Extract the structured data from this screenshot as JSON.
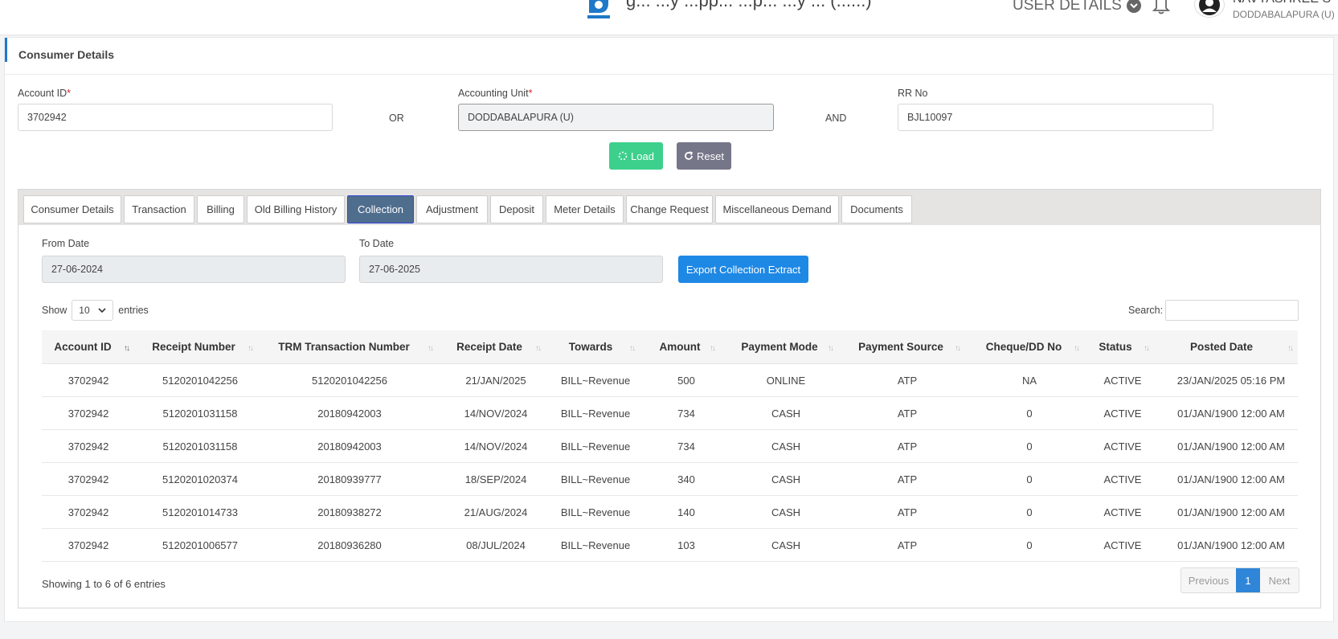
{
  "header": {
    "app_title": "g... ...y ...pp... ...p... ...y ... (......)",
    "user_details_label": "USER DETAILS",
    "user_name": "NAVYASHREE S",
    "user_location": "DODDABALAPURA (U)"
  },
  "card": {
    "title": "Consumer Details"
  },
  "form": {
    "account_id_label": "Account ID",
    "account_id_value": "3702942",
    "or_label": "OR",
    "accounting_unit_label": "Accounting Unit",
    "accounting_unit_value": "DODDABALAPURA (U)",
    "and_label": "AND",
    "rr_no_label": "RR No",
    "rr_no_value": "BJL10097",
    "required_mark": "*",
    "load_label": "Load",
    "reset_label": "Reset"
  },
  "tabs": [
    {
      "label": "Consumer Details"
    },
    {
      "label": "Transaction"
    },
    {
      "label": "Billing"
    },
    {
      "label": "Old Billing History"
    },
    {
      "label": "Collection"
    },
    {
      "label": "Adjustment"
    },
    {
      "label": "Deposit"
    },
    {
      "label": "Meter Details"
    },
    {
      "label": "Change Request"
    },
    {
      "label": "Miscellaneous Demand"
    },
    {
      "label": "Documents"
    }
  ],
  "active_tab": "Collection",
  "collection": {
    "from_date_label": "From Date",
    "from_date_value": "27-06-2024",
    "to_date_label": "To Date",
    "to_date_value": "27-06-2025",
    "export_label": "Export Collection Extract",
    "show_label": "Show",
    "entries_value": "10",
    "entries_label": "entries",
    "search_label": "Search:",
    "info_text": "Showing 1 to 6 of 6 entries",
    "prev_label": "Previous",
    "page_label": "1",
    "next_label": "Next"
  },
  "table": {
    "columns": [
      "Account ID",
      "Receipt Number",
      "TRM Transaction Number",
      "Receipt Date",
      "Towards",
      "Amount",
      "Payment Mode",
      "Payment Source",
      "Cheque/DD No",
      "Status",
      "Posted Date"
    ],
    "rows": [
      [
        "3702942",
        "5120201042256",
        "5120201042256",
        "21/JAN/2025",
        "BILL~Revenue",
        "500",
        "ONLINE",
        "ATP",
        "NA",
        "ACTIVE",
        "23/JAN/2025 05:16 PM"
      ],
      [
        "3702942",
        "5120201031158",
        "20180942003",
        "14/NOV/2024",
        "BILL~Revenue",
        "734",
        "CASH",
        "ATP",
        "0",
        "ACTIVE",
        "01/JAN/1900 12:00 AM"
      ],
      [
        "3702942",
        "5120201031158",
        "20180942003",
        "14/NOV/2024",
        "BILL~Revenue",
        "734",
        "CASH",
        "ATP",
        "0",
        "ACTIVE",
        "01/JAN/1900 12:00 AM"
      ],
      [
        "3702942",
        "5120201020374",
        "20180939777",
        "18/SEP/2024",
        "BILL~Revenue",
        "340",
        "CASH",
        "ATP",
        "0",
        "ACTIVE",
        "01/JAN/1900 12:00 AM"
      ],
      [
        "3702942",
        "5120201014733",
        "20180938272",
        "21/AUG/2024",
        "BILL~Revenue",
        "140",
        "CASH",
        "ATP",
        "0",
        "ACTIVE",
        "01/JAN/1900 12:00 AM"
      ],
      [
        "3702942",
        "5120201006577",
        "20180936280",
        "08/JUL/2024",
        "BILL~Revenue",
        "103",
        "CASH",
        "ATP",
        "0",
        "ACTIVE",
        "01/JAN/1900 12:00 AM"
      ]
    ]
  }
}
